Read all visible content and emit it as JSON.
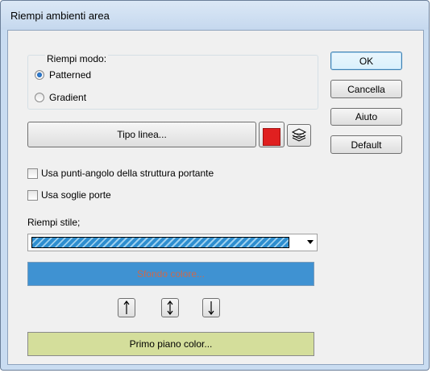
{
  "window": {
    "title": "Riempi ambienti area"
  },
  "fill_mode": {
    "label": "Riempi modo:",
    "options": [
      {
        "label": "Patterned",
        "selected": true
      },
      {
        "label": "Gradient",
        "selected": false
      }
    ]
  },
  "line_type_button": "Tipo linea...",
  "line_color_swatch": "#e02020",
  "checkboxes": [
    {
      "label": "Usa punti-angolo della struttura portante",
      "checked": false
    },
    {
      "label": "Usa soglie porte",
      "checked": false
    }
  ],
  "fill_style": {
    "label": "Riempi stile;",
    "pattern_colors": [
      "#2e8ecf",
      "#9fd1ef"
    ]
  },
  "background_color_button": {
    "label": "Sfondo colore...",
    "color": "#3f92d2"
  },
  "foreground_color_button": {
    "label": "Primo piano color...",
    "color": "#d4de9b"
  },
  "side_buttons": {
    "ok": "OK",
    "cancel": "Cancella",
    "help": "Aiuto",
    "default": "Default"
  },
  "icons": [
    "layers-icon",
    "arrow-up-icon",
    "arrow-updown-icon",
    "arrow-down-icon"
  ]
}
